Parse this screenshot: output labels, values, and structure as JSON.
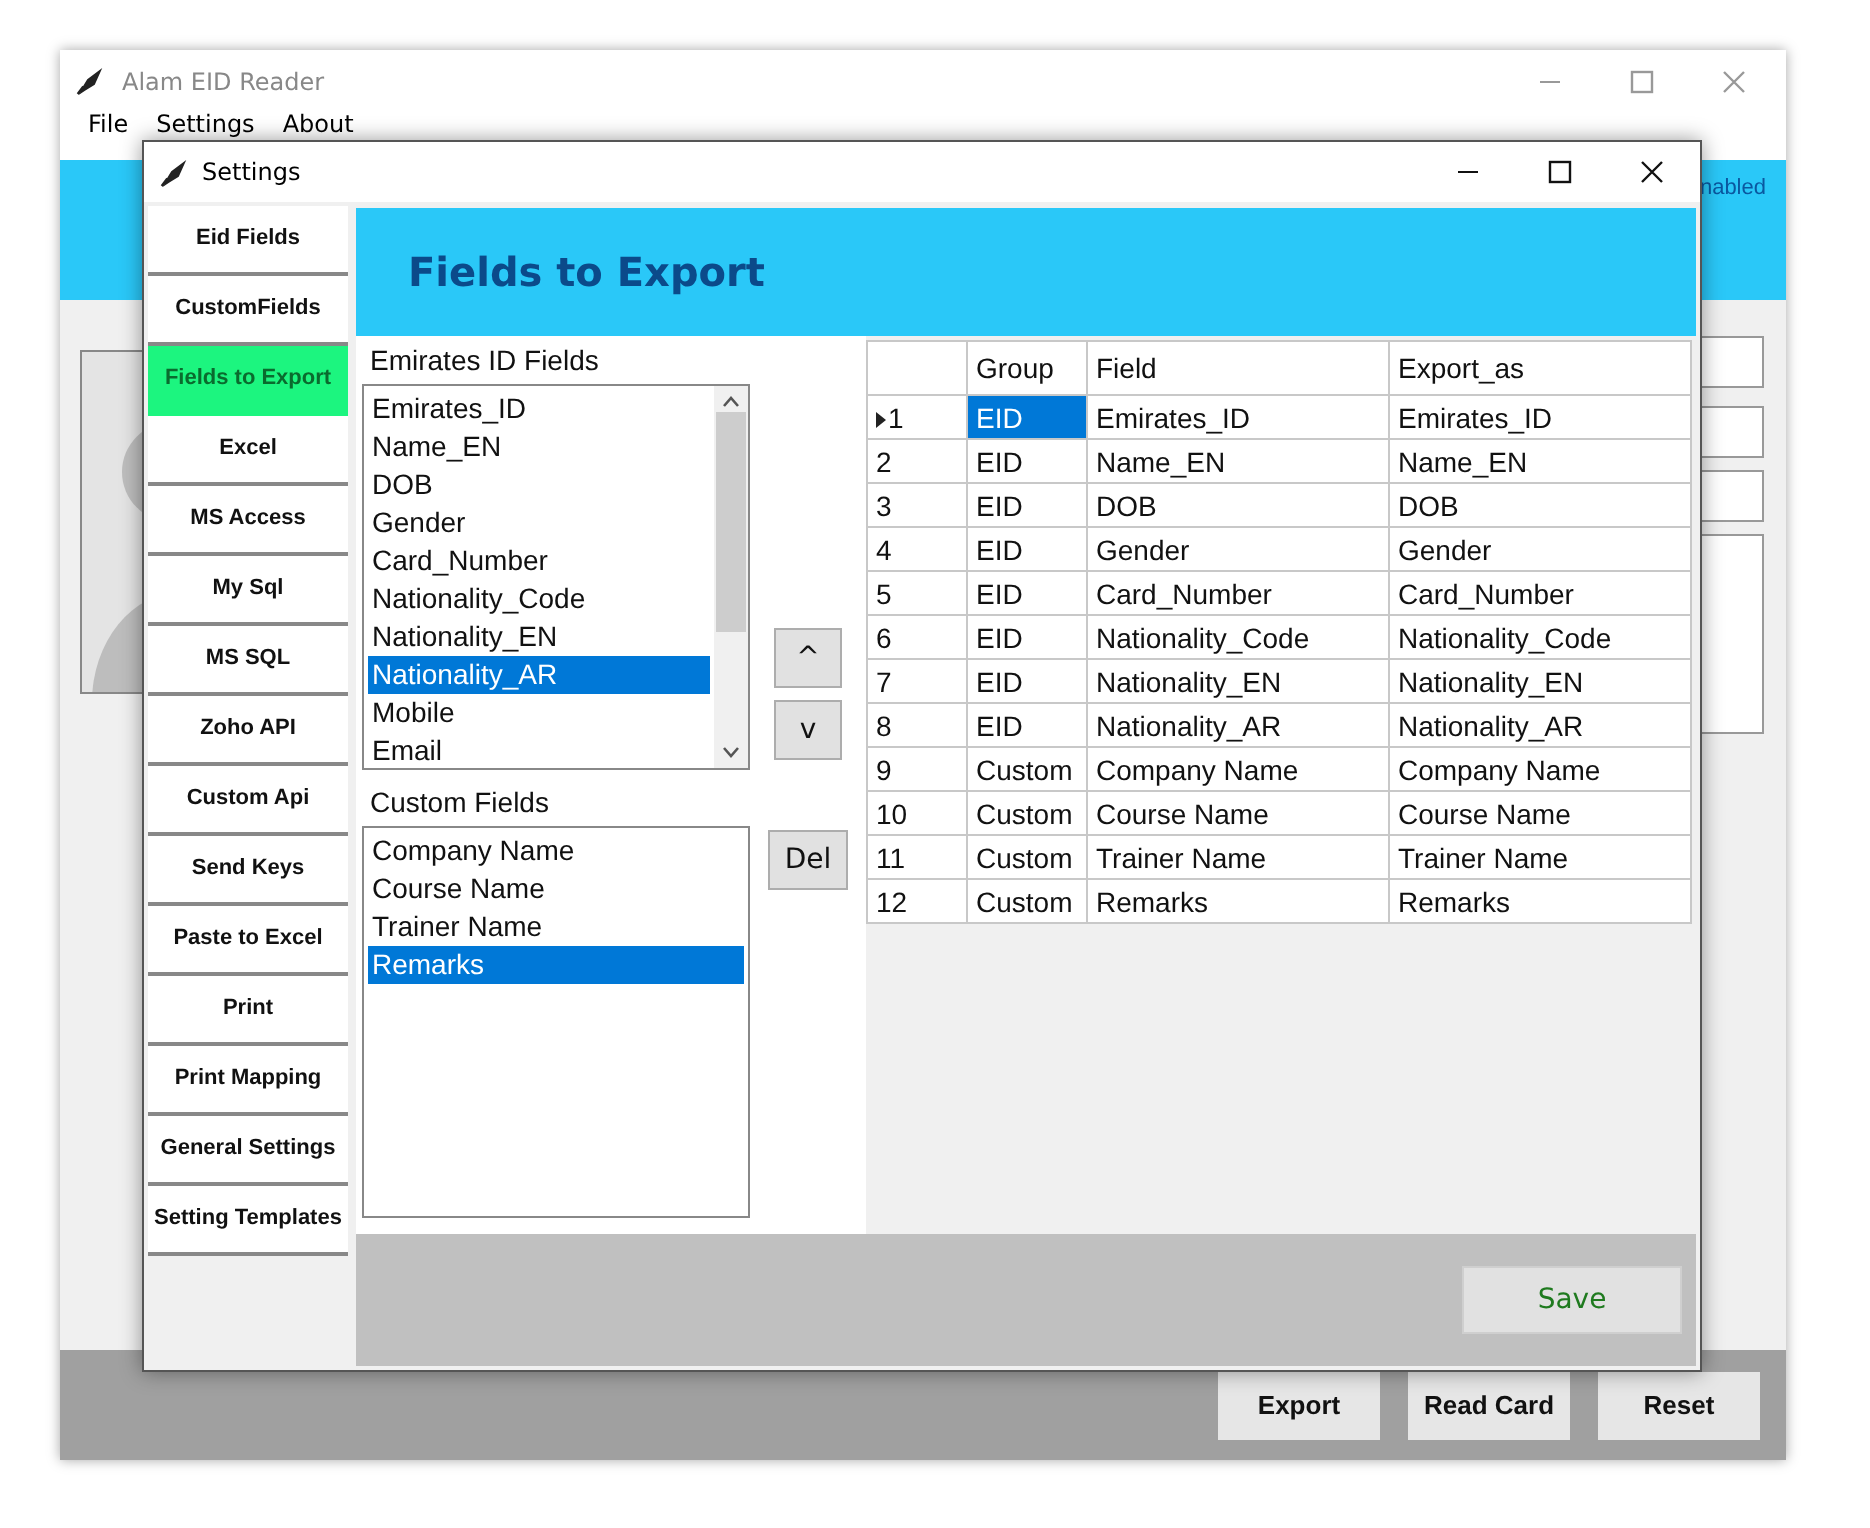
{
  "main_window": {
    "title": "Alam EID Reader",
    "menu": [
      {
        "label": "File"
      },
      {
        "label": "Settings"
      },
      {
        "label": "About"
      }
    ],
    "status_text": "nabled",
    "buttons": [
      "Export",
      "Read Card",
      "Reset"
    ]
  },
  "settings_dialog": {
    "title": "Settings",
    "nav": [
      {
        "label": "Eid Fields",
        "selected": false
      },
      {
        "label": "CustomFields",
        "selected": false
      },
      {
        "label": "Fields to Export",
        "selected": true
      },
      {
        "label": "Excel",
        "selected": false
      },
      {
        "label": "MS Access",
        "selected": false
      },
      {
        "label": "My Sql",
        "selected": false
      },
      {
        "label": "MS SQL",
        "selected": false
      },
      {
        "label": "Zoho API",
        "selected": false
      },
      {
        "label": "Custom Api",
        "selected": false
      },
      {
        "label": "Send Keys",
        "selected": false
      },
      {
        "label": "Paste to Excel",
        "selected": false
      },
      {
        "label": "Print",
        "selected": false
      },
      {
        "label": "Print Mapping",
        "selected": false
      },
      {
        "label": "General Settings",
        "selected": false
      },
      {
        "label": "Setting Templates",
        "selected": false
      }
    ],
    "header": "Fields to Export",
    "eid_fields": {
      "label": "Emirates ID Fields",
      "items": [
        {
          "label": "Emirates_ID",
          "selected": false
        },
        {
          "label": "Name_EN",
          "selected": false
        },
        {
          "label": "DOB",
          "selected": false
        },
        {
          "label": "Gender",
          "selected": false
        },
        {
          "label": "Card_Number",
          "selected": false
        },
        {
          "label": "Nationality_Code",
          "selected": false
        },
        {
          "label": "Nationality_EN",
          "selected": false
        },
        {
          "label": "Nationality_AR",
          "selected": true
        },
        {
          "label": "Mobile",
          "selected": false
        },
        {
          "label": "Email",
          "selected": false
        }
      ]
    },
    "custom_fields": {
      "label": "Custom Fields",
      "items": [
        {
          "label": "Company Name",
          "selected": false
        },
        {
          "label": "Course Name",
          "selected": false
        },
        {
          "label": "Trainer Name",
          "selected": false
        },
        {
          "label": "Remarks",
          "selected": true
        }
      ]
    },
    "move_buttons": [
      "^",
      "v"
    ],
    "delete_button": "Del",
    "grid": {
      "columns": [
        "Group",
        "Field",
        "Export_as"
      ],
      "rows": [
        {
          "number": "1",
          "group": "EID",
          "field": "Emirates_ID",
          "export_as": "Emirates_ID",
          "selected": true
        },
        {
          "number": "2",
          "group": "EID",
          "field": "Name_EN",
          "export_as": "Name_EN",
          "selected": false
        },
        {
          "number": "3",
          "group": "EID",
          "field": "DOB",
          "export_as": "DOB",
          "selected": false
        },
        {
          "number": "4",
          "group": "EID",
          "field": "Gender",
          "export_as": "Gender",
          "selected": false
        },
        {
          "number": "5",
          "group": "EID",
          "field": "Card_Number",
          "export_as": "Card_Number",
          "selected": false
        },
        {
          "number": "6",
          "group": "EID",
          "field": "Nationality_Code",
          "export_as": "Nationality_Code",
          "selected": false
        },
        {
          "number": "7",
          "group": "EID",
          "field": "Nationality_EN",
          "export_as": "Nationality_EN",
          "selected": false
        },
        {
          "number": "8",
          "group": "EID",
          "field": "Nationality_AR",
          "export_as": "Nationality_AR",
          "selected": false
        },
        {
          "number": "9",
          "group": "Custom",
          "field": "Company Name",
          "export_as": "Company Name",
          "selected": false
        },
        {
          "number": "10",
          "group": "Custom",
          "field": "Course Name",
          "export_as": "Course Name",
          "selected": false
        },
        {
          "number": "11",
          "group": "Custom",
          "field": "Trainer Name",
          "export_as": "Trainer Name",
          "selected": false
        },
        {
          "number": "12",
          "group": "Custom",
          "field": "Remarks",
          "export_as": "Remarks",
          "selected": false
        }
      ]
    },
    "save_button": "Save"
  }
}
